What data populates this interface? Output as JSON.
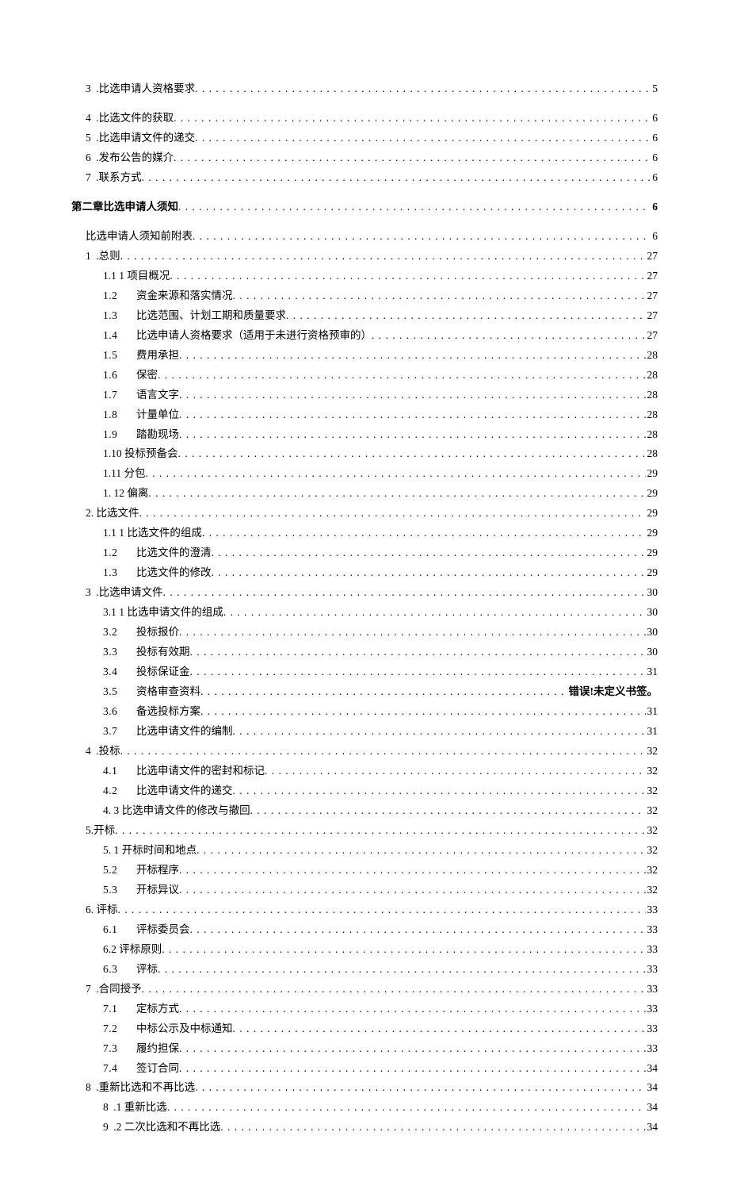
{
  "toc": [
    {
      "indent": "indent-1",
      "num": "3",
      "title": ".比选申请人资格要求",
      "page": "5",
      "spacer_after": true
    },
    {
      "indent": "indent-1",
      "num": "4",
      "title": ".比选文件的获取",
      "page": "6"
    },
    {
      "indent": "indent-1",
      "num": "5",
      "title": ".比选申请文件的递交",
      "page": "6"
    },
    {
      "indent": "indent-1",
      "num": "6",
      "title": ".发布公告的媒介",
      "page": "6"
    },
    {
      "indent": "indent-1",
      "num": "7",
      "title": ".联系方式",
      "page": "6",
      "spacer_after": true
    },
    {
      "indent": "",
      "num": "",
      "title": "第二章比选申请人须知",
      "page": "6",
      "chapter": true,
      "spacer_after": true
    },
    {
      "indent": "indent-2",
      "num": "",
      "title": "比选申请人须知前附表",
      "page": "6"
    },
    {
      "indent": "indent-2",
      "num": "1",
      "title": " .总则",
      "page": "27"
    },
    {
      "indent": "indent-3",
      "num": "",
      "title": "1.1 1 项目概况",
      "page": "27"
    },
    {
      "indent": "indent-3",
      "num_fixed": "1.2",
      "title": "资金来源和落实情况",
      "page": "27"
    },
    {
      "indent": "indent-3",
      "num_fixed": "1.3",
      "title": "比选范围、计划工期和质量要求",
      "page": "27"
    },
    {
      "indent": "indent-3",
      "num_fixed": "1.4",
      "title": "比选申请人资格要求（适用于未进行资格预审的）",
      "page": "27"
    },
    {
      "indent": "indent-3",
      "num_fixed": "1.5",
      "title": "费用承担",
      "page": "28"
    },
    {
      "indent": "indent-3",
      "num_fixed": "1.6",
      "title": "保密",
      "page": "28"
    },
    {
      "indent": "indent-3",
      "num_fixed": "1.7",
      "title": "语言文字",
      "page": "28"
    },
    {
      "indent": "indent-3",
      "num_fixed": "1.8",
      "title": "计量单位",
      "page": "28"
    },
    {
      "indent": "indent-3",
      "num_fixed": "1.9",
      "title": "踏勘现场",
      "page": "28"
    },
    {
      "indent": "indent-3",
      "num": "",
      "title": "1.10 投标预备会",
      "page": "28"
    },
    {
      "indent": "indent-3",
      "num": "",
      "title": "1.11 分包",
      "page": "29"
    },
    {
      "indent": "indent-3",
      "num": "",
      "title": "1.  12 偏离",
      "page": "29"
    },
    {
      "indent": "indent-2",
      "num": "",
      "title": "2.  比选文件",
      "page": "29"
    },
    {
      "indent": "indent-3",
      "num": "",
      "title": "1.1 1 比选文件的组成",
      "page": "29"
    },
    {
      "indent": "indent-3",
      "num_fixed": "1.2",
      "title": "比选文件的澄清",
      "page": "29"
    },
    {
      "indent": "indent-3",
      "num_fixed": "1.3",
      "title": "比选文件的修改",
      "page": "29"
    },
    {
      "indent": "indent-2",
      "num": "3",
      "title": "  .比选申请文件",
      "page": "30"
    },
    {
      "indent": "indent-3",
      "num": "",
      "title": "3.1 1 比选申请文件的组成",
      "page": "30"
    },
    {
      "indent": "indent-3",
      "num_fixed": "3.2",
      "title": "投标报价",
      "page": "30"
    },
    {
      "indent": "indent-3",
      "num_fixed": "3.3",
      "title": "投标有效期",
      "page": "30"
    },
    {
      "indent": "indent-3",
      "num_fixed": "3.4",
      "title": "投标保证金",
      "page": "31"
    },
    {
      "indent": "indent-3",
      "num_fixed": "3.5",
      "title": "资格审查资料",
      "page_special": "错误!未定义书签。"
    },
    {
      "indent": "indent-3",
      "num_fixed": "3.6",
      "title": "备选投标方案",
      "page": "31"
    },
    {
      "indent": "indent-3",
      "num_fixed": "3.7",
      "title": "比选申请文件的编制",
      "page": "31"
    },
    {
      "indent": "indent-2",
      "num": "4",
      "title": "  .投标",
      "page": "32"
    },
    {
      "indent": "indent-3",
      "num_fixed": "4.1",
      "title": "比选申请文件的密封和标记",
      "page": "32"
    },
    {
      "indent": "indent-3",
      "num_fixed": "4.2",
      "title": "比选申请文件的递交",
      "page": "32"
    },
    {
      "indent": "indent-3",
      "num": "",
      "title": "4.  3 比选申请文件的修改与撤回",
      "page": "32"
    },
    {
      "indent": "indent-2",
      "num": "",
      "title": "5.开标",
      "page": "32"
    },
    {
      "indent": "indent-3",
      "num": "",
      "title": "5.   1 开标时间和地点",
      "page": "32"
    },
    {
      "indent": "indent-3",
      "num_fixed": "5.2",
      "title": "开标程序",
      "page": "32"
    },
    {
      "indent": "indent-3",
      "num_fixed": "5.3",
      "title": "开标异议",
      "page": "32"
    },
    {
      "indent": "indent-2",
      "num": "",
      "title": "6.  评标",
      "page": "33"
    },
    {
      "indent": "indent-3",
      "num_fixed": "6.1",
      "title": "评标委员会",
      "page": "33"
    },
    {
      "indent": "indent-3",
      "num": "",
      "title": "6.2 评标原则",
      "page": "33"
    },
    {
      "indent": "indent-3",
      "num_fixed": "6.3",
      "title": "评标",
      "page": "33"
    },
    {
      "indent": "indent-2",
      "num": "7",
      "title": "  .合同授予",
      "page": "33"
    },
    {
      "indent": "indent-3",
      "num_fixed": "7.1",
      "title": "定标方式",
      "page": "33"
    },
    {
      "indent": "indent-3",
      "num_fixed": "7.2",
      "title": "中标公示及中标通知",
      "page": "33"
    },
    {
      "indent": "indent-3",
      "num_fixed": "7.3",
      "title": "履约担保",
      "page": "33"
    },
    {
      "indent": "indent-3",
      "num_fixed": "7.4",
      "title": "签订合同",
      "page": "34"
    },
    {
      "indent": "indent-2",
      "num": "8",
      "title": "  .重新比选和不再比选",
      "page": "34"
    },
    {
      "indent": "indent-3",
      "num": "8",
      "title": "  .1 重新比选",
      "page": "34"
    },
    {
      "indent": "indent-3",
      "num": "9",
      "title": "  .2 二次比选和不再比选",
      "page": "34"
    }
  ]
}
